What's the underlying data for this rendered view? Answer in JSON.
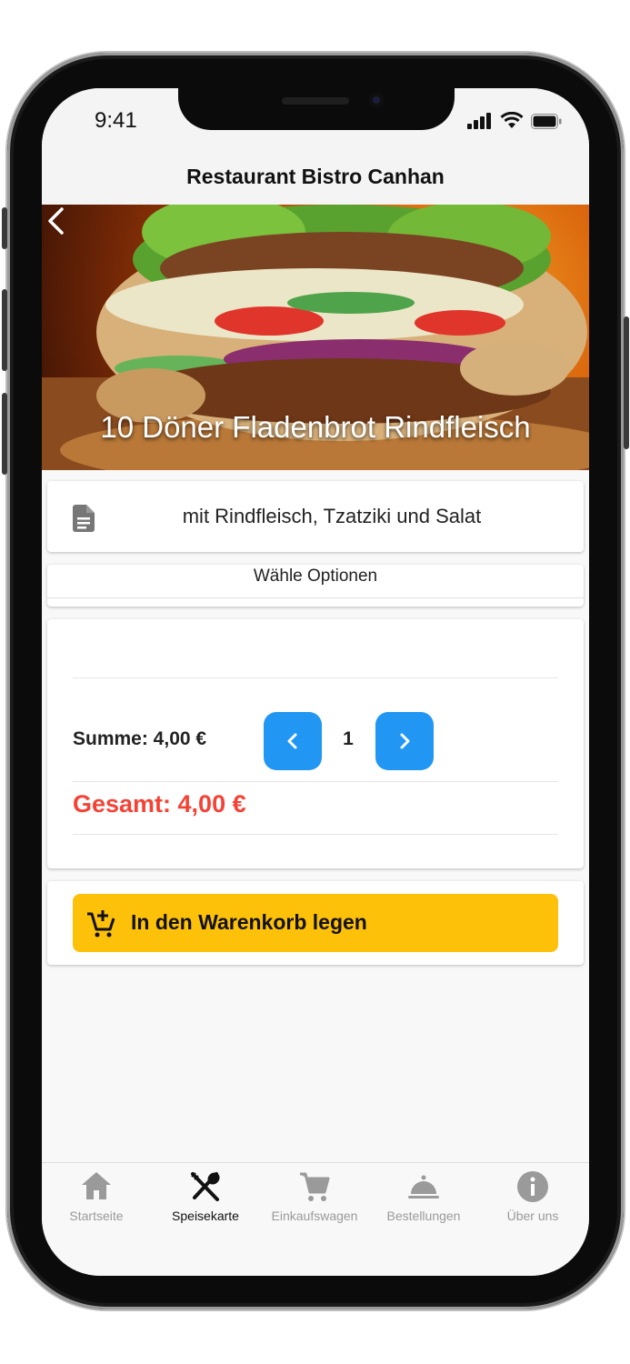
{
  "status_bar": {
    "time": "9:41"
  },
  "app_bar": {
    "title": "Restaurant Bistro Canhan"
  },
  "product": {
    "title": "10 Döner Fladenbrot Rindfleisch",
    "description": "mit Rindfleisch, Tzatziki und Salat",
    "options_title": "Wähle Optionen"
  },
  "quantity": {
    "summe_label": "Summe: 4,00 €",
    "value": "1",
    "gesamt_label": "Gesamt: 4,00 €"
  },
  "cart_button": {
    "label": "In den Warenkorb legen"
  },
  "colors": {
    "accent_blue": "#2196f3",
    "cart_yellow": "#fec10a",
    "total_red": "#f44336"
  },
  "tabs": [
    {
      "label": "Startseite",
      "icon": "home-icon",
      "active": false
    },
    {
      "label": "Speisekarte",
      "icon": "fork-spoon-icon",
      "active": true
    },
    {
      "label": "Einkaufswagen",
      "icon": "cart-icon",
      "active": false
    },
    {
      "label": "Bestellungen",
      "icon": "cloche-icon",
      "active": false
    },
    {
      "label": "Über uns",
      "icon": "info-icon",
      "active": false
    }
  ]
}
